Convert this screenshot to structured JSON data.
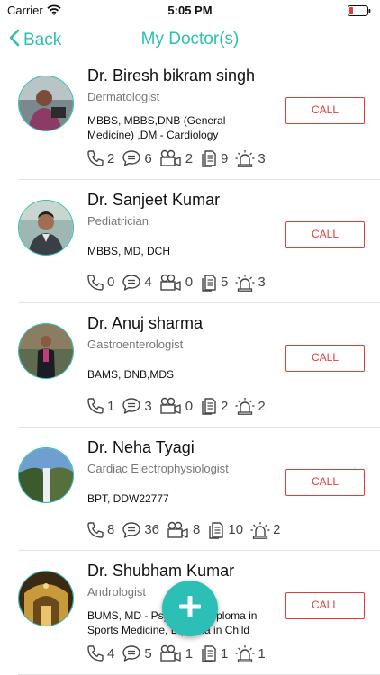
{
  "status_bar": {
    "carrier": "Carrier",
    "time": "5:05 PM"
  },
  "nav": {
    "back_label": "Back",
    "title": "My Doctor(s)"
  },
  "call_label": "CALL",
  "colors": {
    "accent": "#2bbfb5",
    "call": "#e23b3b"
  },
  "doctors": [
    {
      "name": "Dr. Biresh bikram singh",
      "specialty": "Dermatologist",
      "degree": "MBBS, MBBS,DNB (General Medicine) ,DM - Cardiology",
      "calls": "2",
      "chats": "6",
      "videos": "2",
      "reports": "9",
      "alerts": "3"
    },
    {
      "name": "Dr. Sanjeet Kumar",
      "specialty": "Pediatrician",
      "degree": "MBBS, MD, DCH",
      "calls": "0",
      "chats": "4",
      "videos": "0",
      "reports": "5",
      "alerts": "3"
    },
    {
      "name": "Dr. Anuj sharma",
      "specialty": "Gastroenterologist",
      "degree": "BAMS, DNB,MDS",
      "calls": "1",
      "chats": "3",
      "videos": "0",
      "reports": "2",
      "alerts": "2"
    },
    {
      "name": "Dr. Neha Tyagi",
      "specialty": "Cardiac Electrophysiologist",
      "degree": "BPT, DDW22777",
      "calls": "8",
      "chats": "36",
      "videos": "8",
      "reports": "10",
      "alerts": "2"
    },
    {
      "name": "Dr. Shubham Kumar",
      "specialty": "Andrologist",
      "degree": "BUMS, MD - Psychiatry, Diploma in Sports Medicine, Diploma in Child",
      "calls": "4",
      "chats": "5",
      "videos": "1",
      "reports": "1",
      "alerts": "1"
    }
  ]
}
